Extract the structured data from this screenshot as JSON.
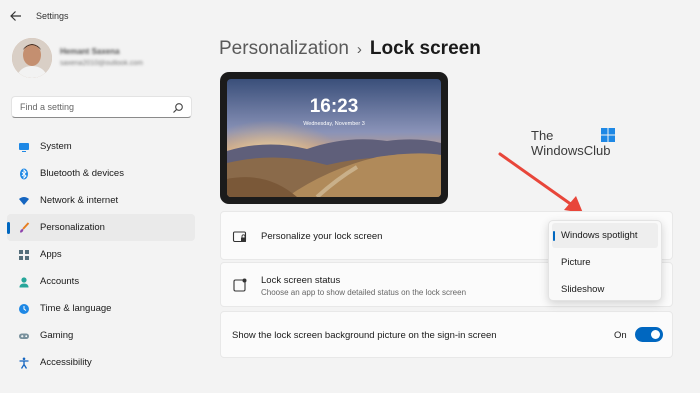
{
  "window": {
    "title": "Settings"
  },
  "profile": {
    "name": "Hemant Saxena",
    "email": "saxena2010@outlook.com"
  },
  "search": {
    "placeholder": "Find a setting"
  },
  "nav": [
    {
      "label": "System",
      "icon": "monitor-icon"
    },
    {
      "label": "Bluetooth & devices",
      "icon": "bluetooth-icon"
    },
    {
      "label": "Network & internet",
      "icon": "wifi-icon"
    },
    {
      "label": "Personalization",
      "icon": "brush-icon",
      "active": true
    },
    {
      "label": "Apps",
      "icon": "apps-icon"
    },
    {
      "label": "Accounts",
      "icon": "person-icon"
    },
    {
      "label": "Time & language",
      "icon": "globe-clock-icon"
    },
    {
      "label": "Gaming",
      "icon": "gamepad-icon"
    },
    {
      "label": "Accessibility",
      "icon": "accessibility-icon"
    }
  ],
  "breadcrumb": {
    "parent": "Personalization",
    "separator": "›",
    "current": "Lock screen"
  },
  "preview": {
    "time": "16:23",
    "date": "Wednesday, November 3"
  },
  "watermark": {
    "line1": "The",
    "line2": "WindowsClub"
  },
  "settings": {
    "personalize": {
      "label": "Personalize your lock screen"
    },
    "status": {
      "label": "Lock screen status",
      "description": "Choose an app to show detailed status on the lock screen"
    },
    "signin": {
      "label": "Show the lock screen background picture on the sign-in screen",
      "toggle_label": "On",
      "toggle_on": true
    }
  },
  "dropdown": {
    "options": [
      "Windows spotlight",
      "Picture",
      "Slideshow"
    ],
    "selected": "Windows spotlight"
  },
  "colors": {
    "accent": "#0067c0",
    "annotation_arrow": "#e8463a",
    "background": "#f3f3f3"
  }
}
